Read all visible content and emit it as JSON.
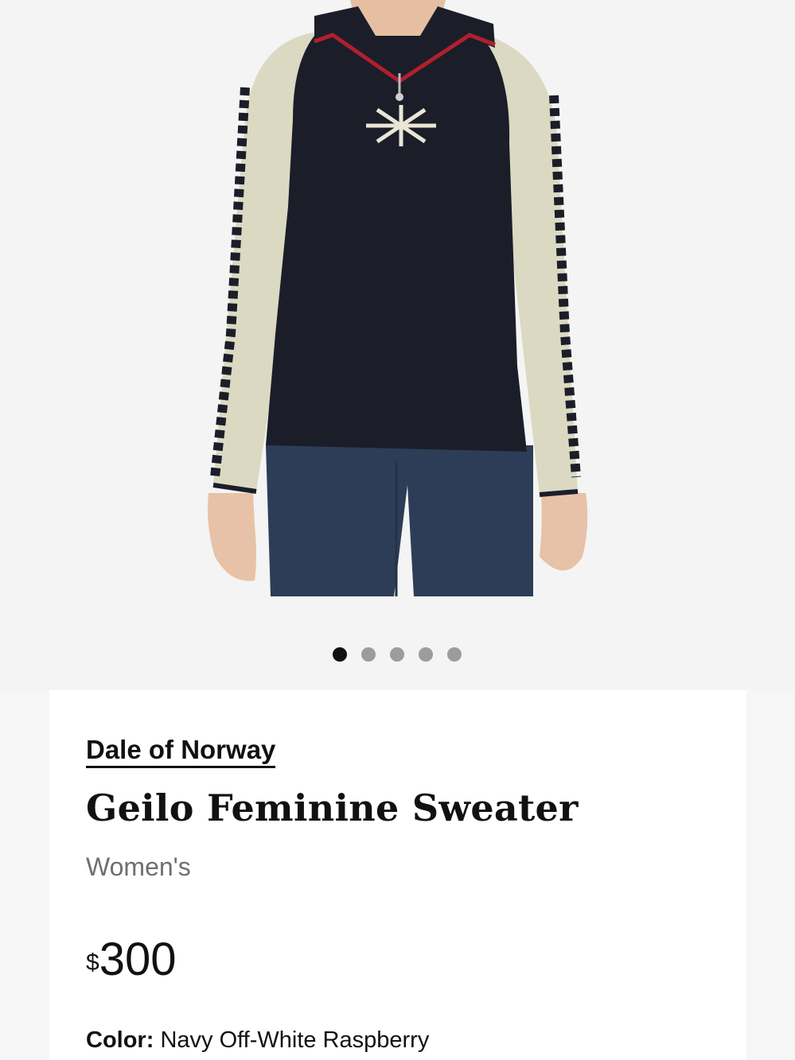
{
  "gallery": {
    "image_alt": "Geilo Feminine Sweater",
    "dot_count": 5,
    "active_index": 0
  },
  "product": {
    "brand": "Dale of Norway",
    "title": "Geilo Feminine Sweater",
    "category": "Women's",
    "price_currency": "$",
    "price_amount": "300",
    "color_label": "Color:",
    "color_value": "Navy Off-White Raspberry"
  },
  "colors": {
    "background": "#f4f4f4",
    "card": "#ffffff",
    "text": "#111111",
    "muted": "#6f6f6f",
    "dot_active": "#111111",
    "dot_inactive": "#9c9c9c",
    "sweater_body": "#1b1e29",
    "sweater_sleeve": "#dcd9c2",
    "collar_accent": "#b21f2d",
    "jeans": "#2e3d57"
  }
}
